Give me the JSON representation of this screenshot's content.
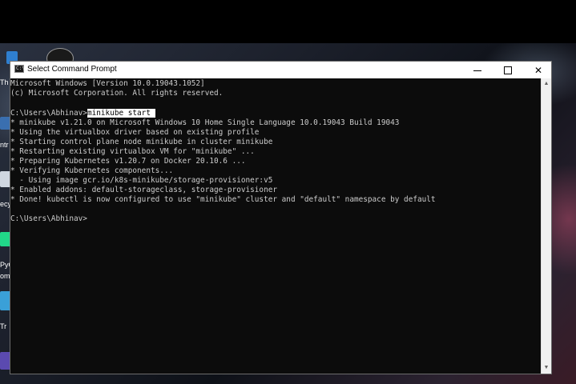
{
  "window": {
    "title": "Select Command Prompt",
    "icon_text": "C:\\",
    "controls": {
      "minimize_icon": "minimize-icon",
      "maximize_icon": "maximize-icon",
      "close_icon": "close-icon"
    }
  },
  "terminal": {
    "lines": [
      "Microsoft Windows [Version 10.0.19043.1052]",
      "(c) Microsoft Corporation. All rights reserved.",
      "",
      "C:\\Users\\Abhinav>minikube start",
      "* minikube v1.21.0 on Microsoft Windows 10 Home Single Language 10.0.19043 Build 19043",
      "* Using the virtualbox driver based on existing profile",
      "* Starting control plane node minikube in cluster minikube",
      "* Restarting existing virtualbox VM for \"minikube\" ...",
      "* Preparing Kubernetes v1.20.7 on Docker 20.10.6 ...",
      "* Verifying Kubernetes components...",
      "  - Using image gcr.io/k8s-minikube/storage-provisioner:v5",
      "* Enabled addons: default-storageclass, storage-provisioner",
      "* Done! kubectl is now configured to use \"minikube\" cluster and \"default\" namespace by default",
      "",
      "C:\\Users\\Abhinav>"
    ],
    "prompt": "C:\\Users\\Abhinav>",
    "selected_command": "minikube start"
  },
  "desktop": {
    "labels": [
      "Th",
      "ntr",
      "ecy",
      "PyC",
      "om",
      "Tr"
    ]
  }
}
